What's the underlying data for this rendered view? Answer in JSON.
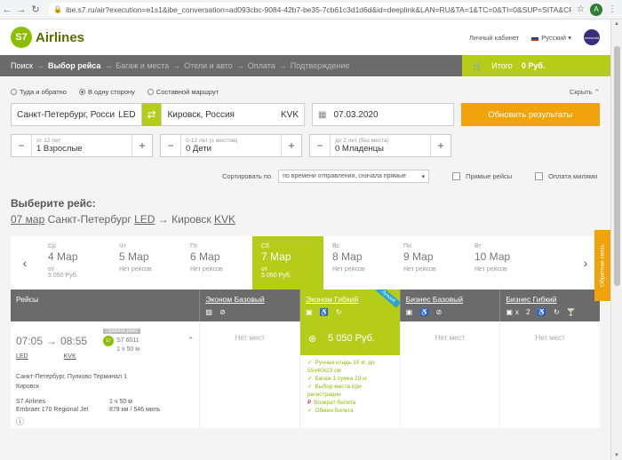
{
  "browser": {
    "url": "ibe.s7.ru/air?execution=e1s1&ibe_conversation=ad093cbc-9084-42b7-be35-7cb61c3d1d6d&id=deeplink&LAN=RU&TA=1&TC=0&TI=0&SUP=SITA&CP+F&RDMP...",
    "avatar_letter": "A"
  },
  "header": {
    "logo_text": "Airlines",
    "logo_mark": "S7",
    "account": "Личный кабинет",
    "language": "Русский",
    "oneworld": "oneworld"
  },
  "steps": {
    "items": [
      "Поиск",
      "Выбор рейса",
      "Багаж и места",
      "Отели и авто",
      "Оплата",
      "Подтверждение"
    ],
    "cart_label": "Итого",
    "cart_total": "0 Руб."
  },
  "options": {
    "round_trip": "Туда и обратно",
    "one_way": "В одну сторону",
    "multi": "Составной маршрут",
    "collapse": "Скрыть"
  },
  "search": {
    "from": "Санкт-Петербург, Росси",
    "from_code": "LED",
    "to": "Кировск, Россия",
    "to_code": "KVK",
    "date": "07.03.2020",
    "update_button": "Обновить результаты"
  },
  "passengers": [
    {
      "hint": "от 12 лет",
      "value": "1 Взрослые"
    },
    {
      "hint": "0-12 лет (с местом)",
      "value": "0 Дети"
    },
    {
      "hint": "до 2 лет (без места)",
      "value": "0 Младенцы"
    }
  ],
  "sort": {
    "label": "Сортировать по",
    "value": "по времени отправления, сначала прямые",
    "direct": "Прямые рейсы",
    "miles": "Оплата милями"
  },
  "results": {
    "title": "Выберите рейс:",
    "route_date": "07 мар",
    "route_from": "Санкт-Петербург",
    "route_from_code": "LED",
    "route_arrow": "→",
    "route_to": "Кировск",
    "route_to_code": "KVK"
  },
  "dates": [
    {
      "dow": "Ср",
      "date": "4 Мар",
      "l1": "от",
      "l2": "5 050 Руб."
    },
    {
      "dow": "Чт",
      "date": "5 Мар",
      "l1": "",
      "l2": "Нет рейсов"
    },
    {
      "dow": "Пт",
      "date": "6 Мар",
      "l1": "",
      "l2": "Нет рейсов"
    },
    {
      "dow": "Сб",
      "date": "7 Мар",
      "l1": "от",
      "l2": "5 050 Руб."
    },
    {
      "dow": "Вс",
      "date": "8 Мар",
      "l1": "",
      "l2": "Нет рейсов"
    },
    {
      "dow": "Пн",
      "date": "9 Мар",
      "l1": "",
      "l2": "Нет рейсов"
    },
    {
      "dow": "Вт",
      "date": "10 Мар",
      "l1": "",
      "l2": "Нет рейсов"
    }
  ],
  "fares": {
    "flights_label": "Рейсы",
    "columns": [
      "Эконом Базовый",
      "Эконом Гибкий",
      "Бизнес Базовый",
      "Бизнес Гибкий"
    ],
    "ribbon": "Лучший",
    "x2": "x 2"
  },
  "flight": {
    "dep_time": "07:05",
    "arr_time": "08:55",
    "dep_code": "LED",
    "arr_code": "KVK",
    "tag": "Прямой рейс",
    "flight_no": "S7 6011",
    "duration": "1 ч 50 м",
    "airport": "Санкт-Петербург, Пулково Терминал 1",
    "dest_city": "Кировск",
    "carrier": "S7 Airlines",
    "duration2": "1 ч 50 м",
    "aircraft": "Embraer 170 Regional Jet",
    "distance": "879 км / 546 миль",
    "no_seats": "Нет мест",
    "price": "5 050 Руб.",
    "perks": [
      "Ручная кладь 10 кг, до 55x40x23 см",
      "Багаж 1 сумка 23 кг",
      "Выбор места при регистрации",
      "Возврат билета",
      "Обмен билета"
    ]
  },
  "feedback": "Обратная связь"
}
